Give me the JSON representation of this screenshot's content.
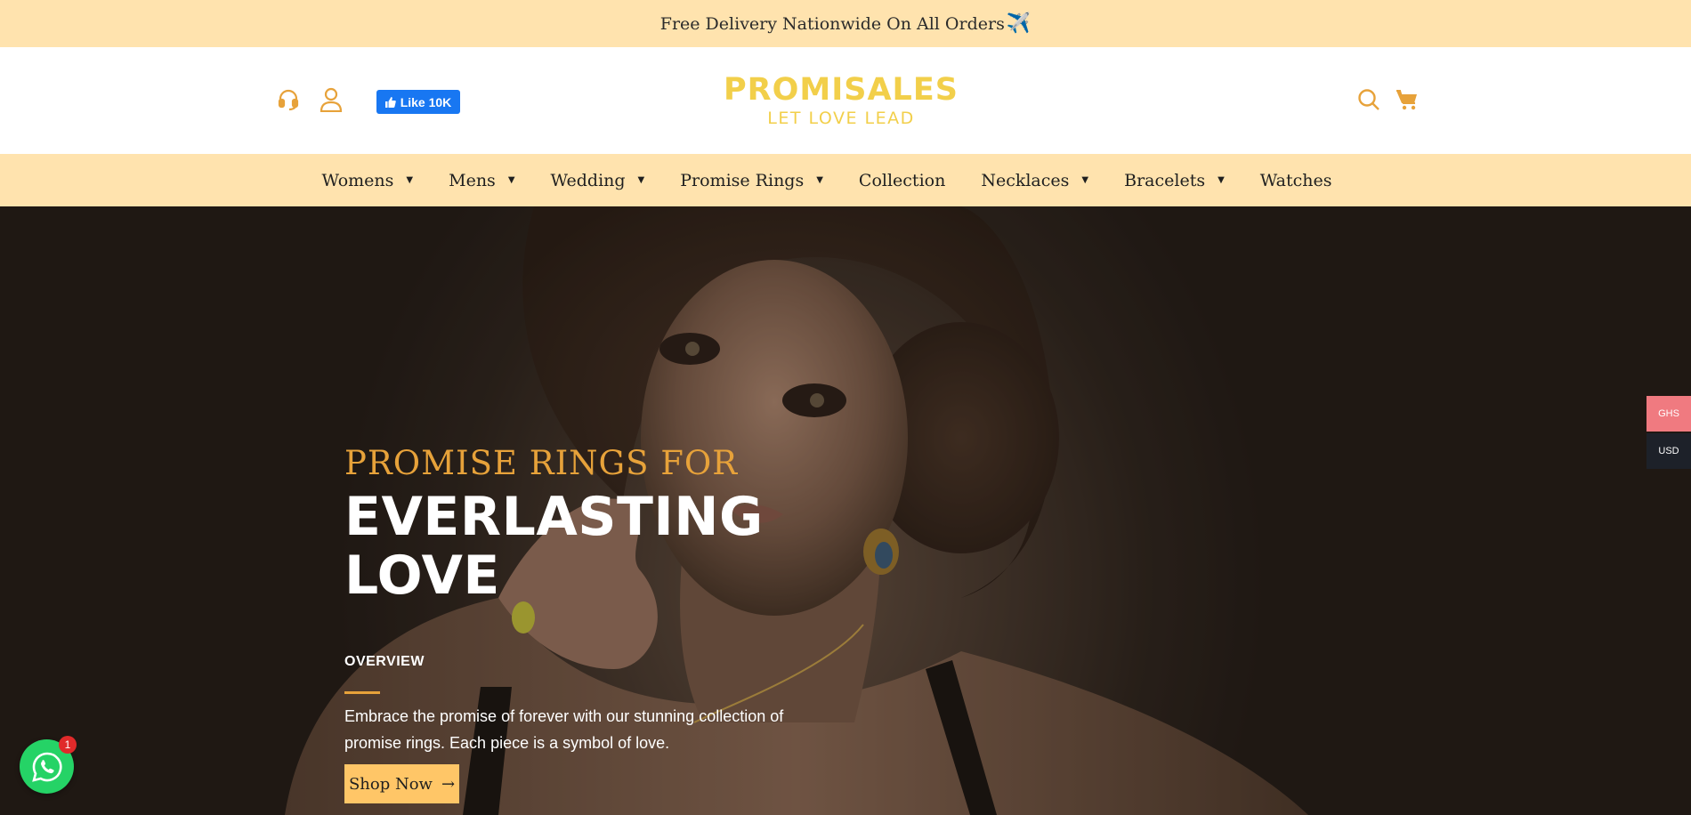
{
  "announcement": {
    "text": "Free Delivery Nationwide On All Orders",
    "emoji": "✈️"
  },
  "header": {
    "facebook_like_label": "Like 10K",
    "logo_title": "PROMISALES",
    "logo_tagline": "LET LOVE LEAD",
    "icons": [
      "support-icon",
      "account-icon",
      "search-icon",
      "cart-icon"
    ],
    "logo_color": "#f2cf4a",
    "icon_color": "#e7a23a"
  },
  "nav": {
    "items": [
      {
        "label": "Womens",
        "has_dropdown": true
      },
      {
        "label": "Mens",
        "has_dropdown": true
      },
      {
        "label": "Wedding",
        "has_dropdown": true
      },
      {
        "label": "Promise Rings",
        "has_dropdown": true
      },
      {
        "label": "Collection",
        "has_dropdown": false
      },
      {
        "label": "Necklaces",
        "has_dropdown": true
      },
      {
        "label": "Bracelets",
        "has_dropdown": true
      },
      {
        "label": "Watches",
        "has_dropdown": false
      }
    ],
    "background": "#ffe3ae"
  },
  "hero": {
    "kicker": "PROMISE RINGS FOR",
    "title_line1": "EVERLASTING",
    "title_line2": "LOVE",
    "overview_label": "OVERVIEW",
    "description": "Embrace the promise of forever with our stunning collection of promise rings. Each piece is a symbol of love.",
    "cta_label": "Shop Now",
    "cta_arrow": "→",
    "accent_color": "#e7a23a",
    "cta_color": "#ffc667"
  },
  "currency": {
    "options": [
      "GHS",
      "USD"
    ],
    "selected": "GHS"
  },
  "whatsapp": {
    "badge_count": "1"
  }
}
